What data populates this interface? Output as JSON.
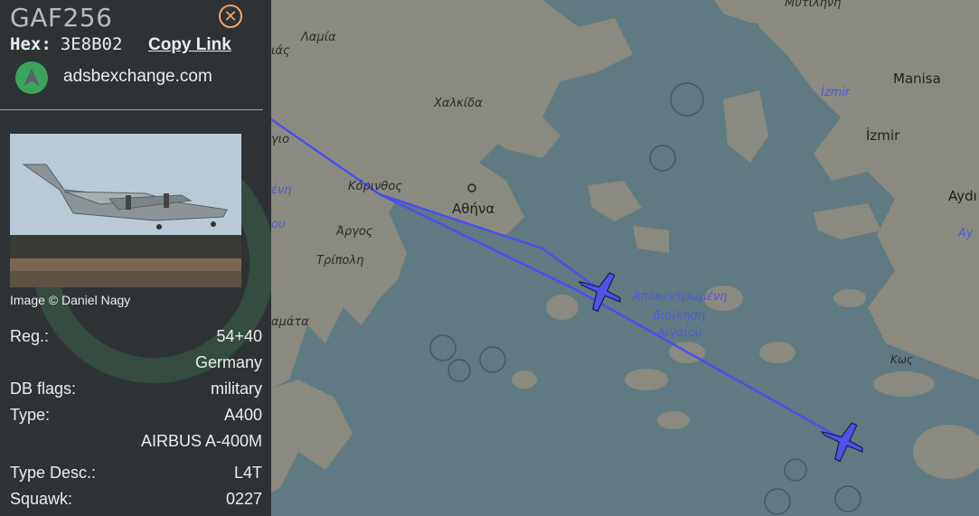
{
  "aircraft": {
    "callsign": "GAF256",
    "hex_label": "Hex:",
    "hex": "3E8B02",
    "copy_link": "Copy Link",
    "source_site": "adsbexchange.com",
    "image_credit": "Image © Daniel Nagy",
    "reg_label": "Reg.:",
    "reg": "54+40",
    "country": "Germany",
    "db_flags_label": "DB flags:",
    "db_flags": "military",
    "type_label": "Type:",
    "type": "A400",
    "type_full": "AIRBUS A-400M",
    "type_desc_label": "Type Desc.:",
    "type_desc": "L4T",
    "squawk_label": "Squawk:",
    "squawk": "0227"
  },
  "map": {
    "labels": {
      "lamia": "Λαμία",
      "as": "ιάς",
      "chalkida": "Χαλκίδα",
      "korinthos": "Κόρινθος",
      "athina": "Αθήνα",
      "argos": "Άργος",
      "tripoli": "Τρίπολη",
      "kalamata": "αμάτα",
      "aigaio_1": "Αποκεντρωμένη",
      "aigaio_2": "Διοίκηση",
      "aigaio_3": "Αιγαίου",
      "mytilini": "Μυτιλήνη",
      "manisa": "Manisa",
      "izmir": "İzmir",
      "izmir_it": "İzmir",
      "aydin": "Aydı",
      "ay_it": "Ay",
      "kos": "Κως",
      "gio": "γιο",
      "eni": "ένη",
      "ou": "ου"
    },
    "colors": {
      "sea": "#5f7a80",
      "land": "#8b8a80",
      "track": "#4a4ff0",
      "plane": "#4f52e6"
    },
    "icons": {
      "plane_1": "plane-icon",
      "plane_2": "plane-icon"
    }
  }
}
